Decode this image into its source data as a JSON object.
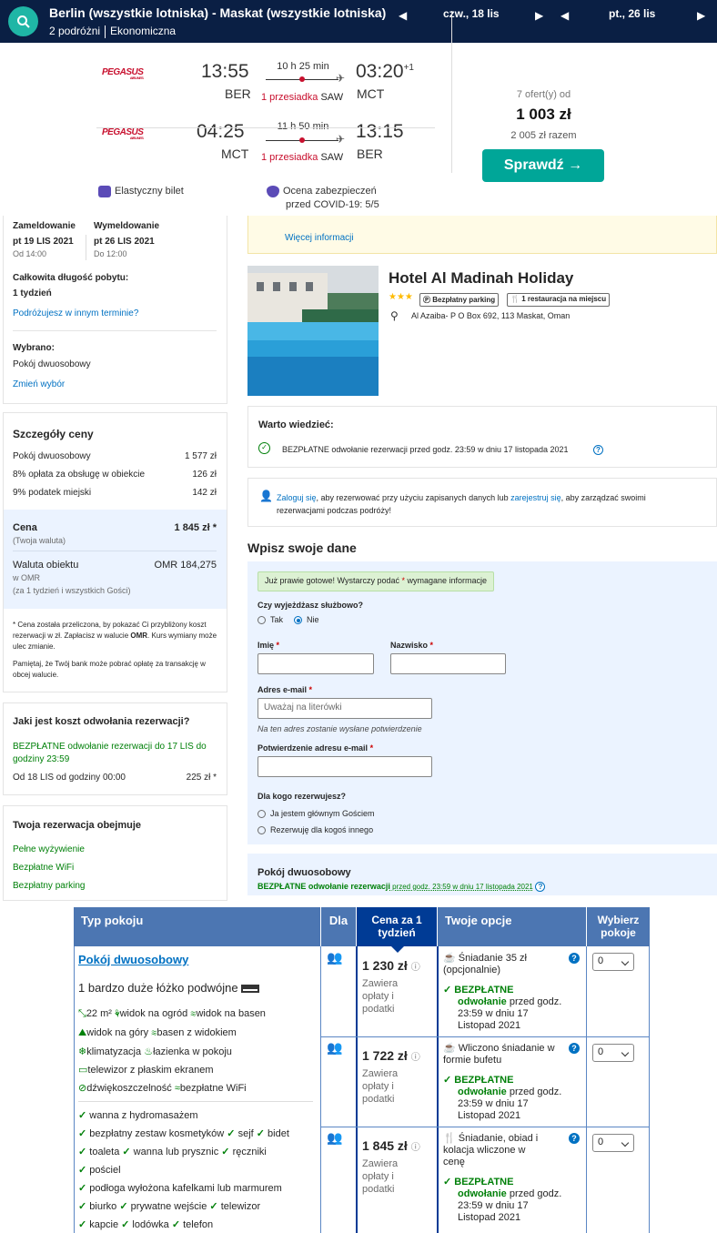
{
  "flight_bar": {
    "route": "Berlin (wszystkie lotniska) - Maskat (wszystkie lotniska)",
    "travellers": "2 podróżni",
    "cabin": "Ekonomiczna",
    "depart_date": "czw., 18 lis",
    "return_date": "pt., 26 lis"
  },
  "flight_card": {
    "outbound": {
      "airline": "PEGASUS",
      "airline_sub": "AIRLINES",
      "dep_time": "13:55",
      "dep_airport": "BER",
      "duration": "10 h 25 min",
      "stops": "1 przesiadka",
      "stop_airport": "SAW",
      "arr_time": "03:20",
      "arr_day_offset": "+1",
      "arr_airport": "MCT"
    },
    "inbound": {
      "airline": "PEGASUS",
      "airline_sub": "AIRLINES",
      "dep_time": "04:25",
      "dep_airport": "MCT",
      "duration": "11 h 50 min",
      "stops": "1 przesiadka",
      "stop_airport": "SAW",
      "arr_time": "13:15",
      "arr_airport": "BER"
    },
    "offers": "7 ofert(y) od",
    "price": "1 003 zł",
    "price_total": "2 005 zł razem",
    "check_button": "Sprawdź →",
    "flexible_ticket": "Elastyczny bilet",
    "covid_rating_line1": "Ocena zabezpieczeń",
    "covid_rating_line2": "przed COVID-19: 5/5"
  },
  "stay": {
    "checkin_label": "Zameldowanie",
    "checkin_date": "pt 19 LIS 2021",
    "checkin_time": "Od 14:00",
    "checkout_label": "Wymeldowanie",
    "checkout_date": "pt 26 LIS 2021",
    "checkout_time": "Do 12:00",
    "length_label": "Całkowita długość pobytu:",
    "length_value": "1 tydzień",
    "other_dates_link": "Podróżujesz w innym terminie?",
    "selected_label": "Wybrano:",
    "selected_value": "Pokój dwuosobowy",
    "change_link": "Zmień wybór"
  },
  "price_details": {
    "title": "Szczegóły ceny",
    "rows": [
      {
        "label": "Pokój dwuosobowy",
        "value": "1 577 zł"
      },
      {
        "label": "8% opłata za obsługę w obiekcie",
        "value": "126 zł"
      },
      {
        "label": "9% podatek miejski",
        "value": "142 zł"
      }
    ],
    "total_label": "Cena",
    "total_value": "1 845 zł *",
    "total_sub": "(Twoja waluta)",
    "currency_label": "Waluta obiektu",
    "currency_value": "OMR 184,275",
    "currency_sub1": "w OMR",
    "currency_sub2": "(za 1 tydzień i wszystkich Gości)",
    "note1_a": "* Cena została przeliczona, by pokazać Ci przybliżony koszt rezerwacji w zł. Zapłacisz w walucie ",
    "note1_b": "OMR",
    "note1_c": ". Kurs wymiany może ulec zmianie.",
    "note2": "Pamiętaj, że Twój bank może pobrać opłatę za transakcję w obcej walucie."
  },
  "cancellation": {
    "title": "Jaki jest koszt odwołania rezerwacji?",
    "free_text": "BEZPŁATNE odwołanie rezerwacji do 17 LIS do godziny 23:59",
    "from_label": "Od 18 LIS od godziny 00:00",
    "from_value": "225 zł *"
  },
  "includes": {
    "title": "Twoja rezerwacja obejmuje",
    "items": [
      "Pełne wyżywienie",
      "Bezpłatne WiFi",
      "Bezpłatny parking"
    ]
  },
  "hotel": {
    "more_info_link": "Więcej informacji",
    "name": "Hotel Al Madinah Holiday",
    "stars": "★★★",
    "chip_parking": "Bezpłatny parking",
    "chip_restaurant": "1 restauracja na miejscu",
    "address": "Al Azaiba- P O Box 692, 113 Maskat, Oman"
  },
  "good_to_know": {
    "title": "Warto wiedzieć:",
    "text": "BEZPŁATNE odwołanie rezerwacji przed godz. 23:59 w dniu 17 listopada 2021"
  },
  "login_notice": {
    "login_link": "Zaloguj się",
    "text1": ", aby rezerwować przy użyciu zapisanych danych lub ",
    "register_link": "zarejestruj się",
    "text2": ", aby zarządzać swoimi rezerwacjami podczas podróży!"
  },
  "form": {
    "title": "Wpisz swoje dane",
    "banner_a": "Już prawie gotowe! Wystarczy podać ",
    "banner_star": "*",
    "banner_b": " wymagane informacje",
    "business_label": "Czy wyjeżdżasz służbowo?",
    "yes": "Tak",
    "no": "Nie",
    "first_name_label": "Imię",
    "last_name_label": "Nazwisko",
    "required_mark": "*",
    "email_label": "Adres e-mail",
    "email_placeholder": "Uważaj na literówki",
    "email_hint": "Na ten adres zostanie wysłane potwierdzenie",
    "email_confirm_label": "Potwierdzenie adresu e-mail",
    "for_whom_label": "Dla kogo rezerwujesz?",
    "option_main_guest": "Ja jestem głównym Gościem",
    "option_other": "Rezerwuję dla kogoś innego",
    "room_title": "Pokój dwuosobowy",
    "room_free_bold": "BEZPŁATNE odwołanie rezerwacji",
    "room_free_rest": " przed godz. 23:59 w dniu 17 listopada 2021"
  },
  "room_table": {
    "headers": {
      "type": "Typ pokoju",
      "for": "Dla",
      "price": "Cena za 1 tydzień",
      "options": "Twoje opcje",
      "choose": "Wybierz pokoje"
    },
    "room_name": "Pokój dwuosobowy",
    "bed": "1 bardzo duże łóżko podwójne",
    "facilities": [
      "22 m²",
      "widok na ogród",
      "widok na basen",
      "widok na góry",
      "basen z widokiem",
      "klimatyzacja",
      "łazienka w pokoju",
      "telewizor z płaskim ekranem",
      "dźwiękoszczelność",
      "bezpłatne WiFi"
    ],
    "amenities": [
      "wanna z hydromasażem",
      "bezpłatny zestaw kosmetyków",
      "sejf",
      "bidet",
      "toaleta",
      "wanna lub prysznic",
      "ręczniki",
      "pościel",
      "podłoga wyłożona kafelkami lub marmurem",
      "biurko",
      "prywatne wejście",
      "telewizor",
      "kapcie",
      "lodówka",
      "telefon"
    ],
    "price_note": [
      "Zawiera",
      "opłaty i",
      "podatki"
    ],
    "free_cancel_bold": "BEZPŁATNE",
    "free_cancel_bold2": "odwołanie",
    "free_cancel_rest1": "przed godz.",
    "free_cancel_rest2": "23:59 w dniu 17",
    "free_cancel_rest3": "Listopad 2021",
    "rows": [
      {
        "price": "1 230 zł",
        "opt_line1": "Śniadanie 35 zł",
        "opt_line2": "(opcjonalnie)",
        "opt_line3": "",
        "qty": "0"
      },
      {
        "price": "1 722 zł",
        "opt_line1": "Wliczono śniadanie w",
        "opt_line2": "formie bufetu",
        "opt_line3": "",
        "qty": "0"
      },
      {
        "price": "1 845 zł",
        "opt_line1": "Śniadanie, obiad i",
        "opt_line2": "kolacja wliczone w",
        "opt_line3": "cenę",
        "qty": "0"
      }
    ]
  },
  "colors": {
    "navy": "#0a1f44",
    "teal": "#00a698",
    "booking_blue": "#0071c2",
    "table_header": "#4c76b2",
    "green": "#008009"
  }
}
